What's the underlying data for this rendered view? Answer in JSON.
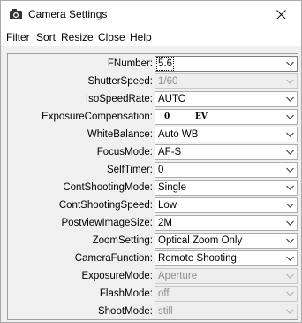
{
  "window": {
    "title": "Camera Settings",
    "icon": "camera-icon",
    "close_icon": "close-icon"
  },
  "menu": [
    "Filter",
    "Sort",
    "Resize",
    "Close",
    "Help"
  ],
  "settings": [
    {
      "label": "FNumber:",
      "value": "5.6",
      "enabled": true,
      "focused": true
    },
    {
      "label": "ShutterSpeed:",
      "value": "1/60",
      "enabled": false
    },
    {
      "label": "IsoSpeedRate:",
      "value": "AUTO",
      "enabled": true
    },
    {
      "label": "ExposureCompensation:",
      "value": "0",
      "unit": "EV",
      "enabled": true,
      "slider": true
    },
    {
      "label": "WhiteBalance:",
      "value": "Auto WB",
      "enabled": true
    },
    {
      "label": "FocusMode:",
      "value": "AF-S",
      "enabled": true
    },
    {
      "label": "SelfTimer:",
      "value": "0",
      "enabled": true
    },
    {
      "label": "ContShootingMode:",
      "value": "Single",
      "enabled": true
    },
    {
      "label": "ContShootingSpeed:",
      "value": "Low",
      "enabled": true
    },
    {
      "label": "PostviewImageSize:",
      "value": "2M",
      "enabled": true
    },
    {
      "label": "ZoomSetting:",
      "value": "Optical Zoom Only",
      "enabled": true
    },
    {
      "label": "CameraFunction:",
      "value": "Remote Shooting",
      "enabled": true
    },
    {
      "label": "ExposureMode:",
      "value": "Aperture",
      "enabled": false
    },
    {
      "label": "FlashMode:",
      "value": "off",
      "enabled": false
    },
    {
      "label": "ShootMode:",
      "value": "still",
      "enabled": false
    }
  ]
}
